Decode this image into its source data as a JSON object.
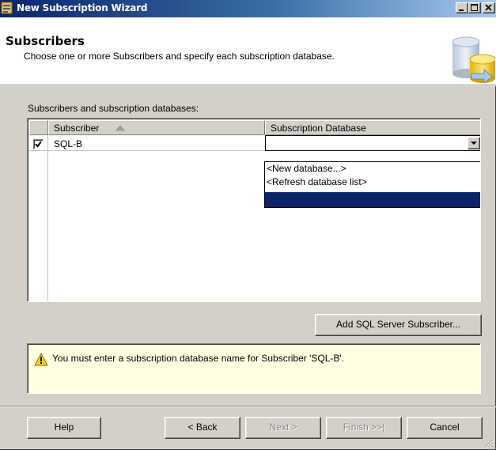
{
  "window": {
    "title": "New Subscription Wizard"
  },
  "header": {
    "title": "Subscribers",
    "subtitle": "Choose one or more Subscribers and specify each subscription database."
  },
  "grid": {
    "label": "Subscribers and subscription databases:",
    "columns": [
      "Subscriber",
      "Subscription Database"
    ],
    "rows": [
      {
        "checked": true,
        "subscriber": "SQL-B",
        "database": ""
      }
    ],
    "dropdown_options": [
      "<New database...>",
      "<Refresh database list>",
      ""
    ],
    "dropdown_selected_index": 2
  },
  "buttons": {
    "add_subscriber": "Add SQL Server Subscriber...",
    "help": "Help",
    "back": "< Back",
    "next": "Next >",
    "finish": "Finish >>|",
    "cancel": "Cancel"
  },
  "message": {
    "icon": "warning-icon",
    "text": "You must enter a subscription database name for Subscriber 'SQL-B'."
  },
  "colors": {
    "title_bar": "#0a246a",
    "selection": "#0a246a",
    "message_bg": "#ffffe1",
    "face": "#d4d0c8"
  }
}
